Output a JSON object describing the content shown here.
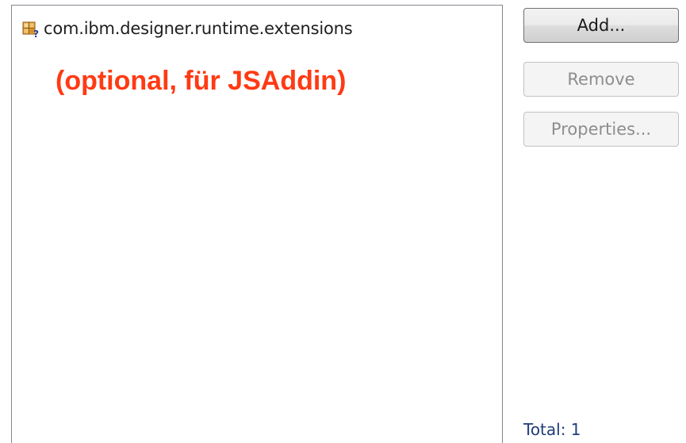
{
  "list": {
    "items": [
      {
        "label": "com.ibm.designer.runtime.extensions",
        "icon": "plugin-unresolved-icon"
      }
    ]
  },
  "annotation": "(optional, für JSAddin)",
  "buttons": {
    "add": "Add...",
    "remove": "Remove",
    "properties": "Properties..."
  },
  "status": {
    "total": "Total: 1"
  },
  "colors": {
    "annotation": "#ff3a14",
    "total_text": "#1f3d7a",
    "disabled_text": "#8d8d8d"
  }
}
